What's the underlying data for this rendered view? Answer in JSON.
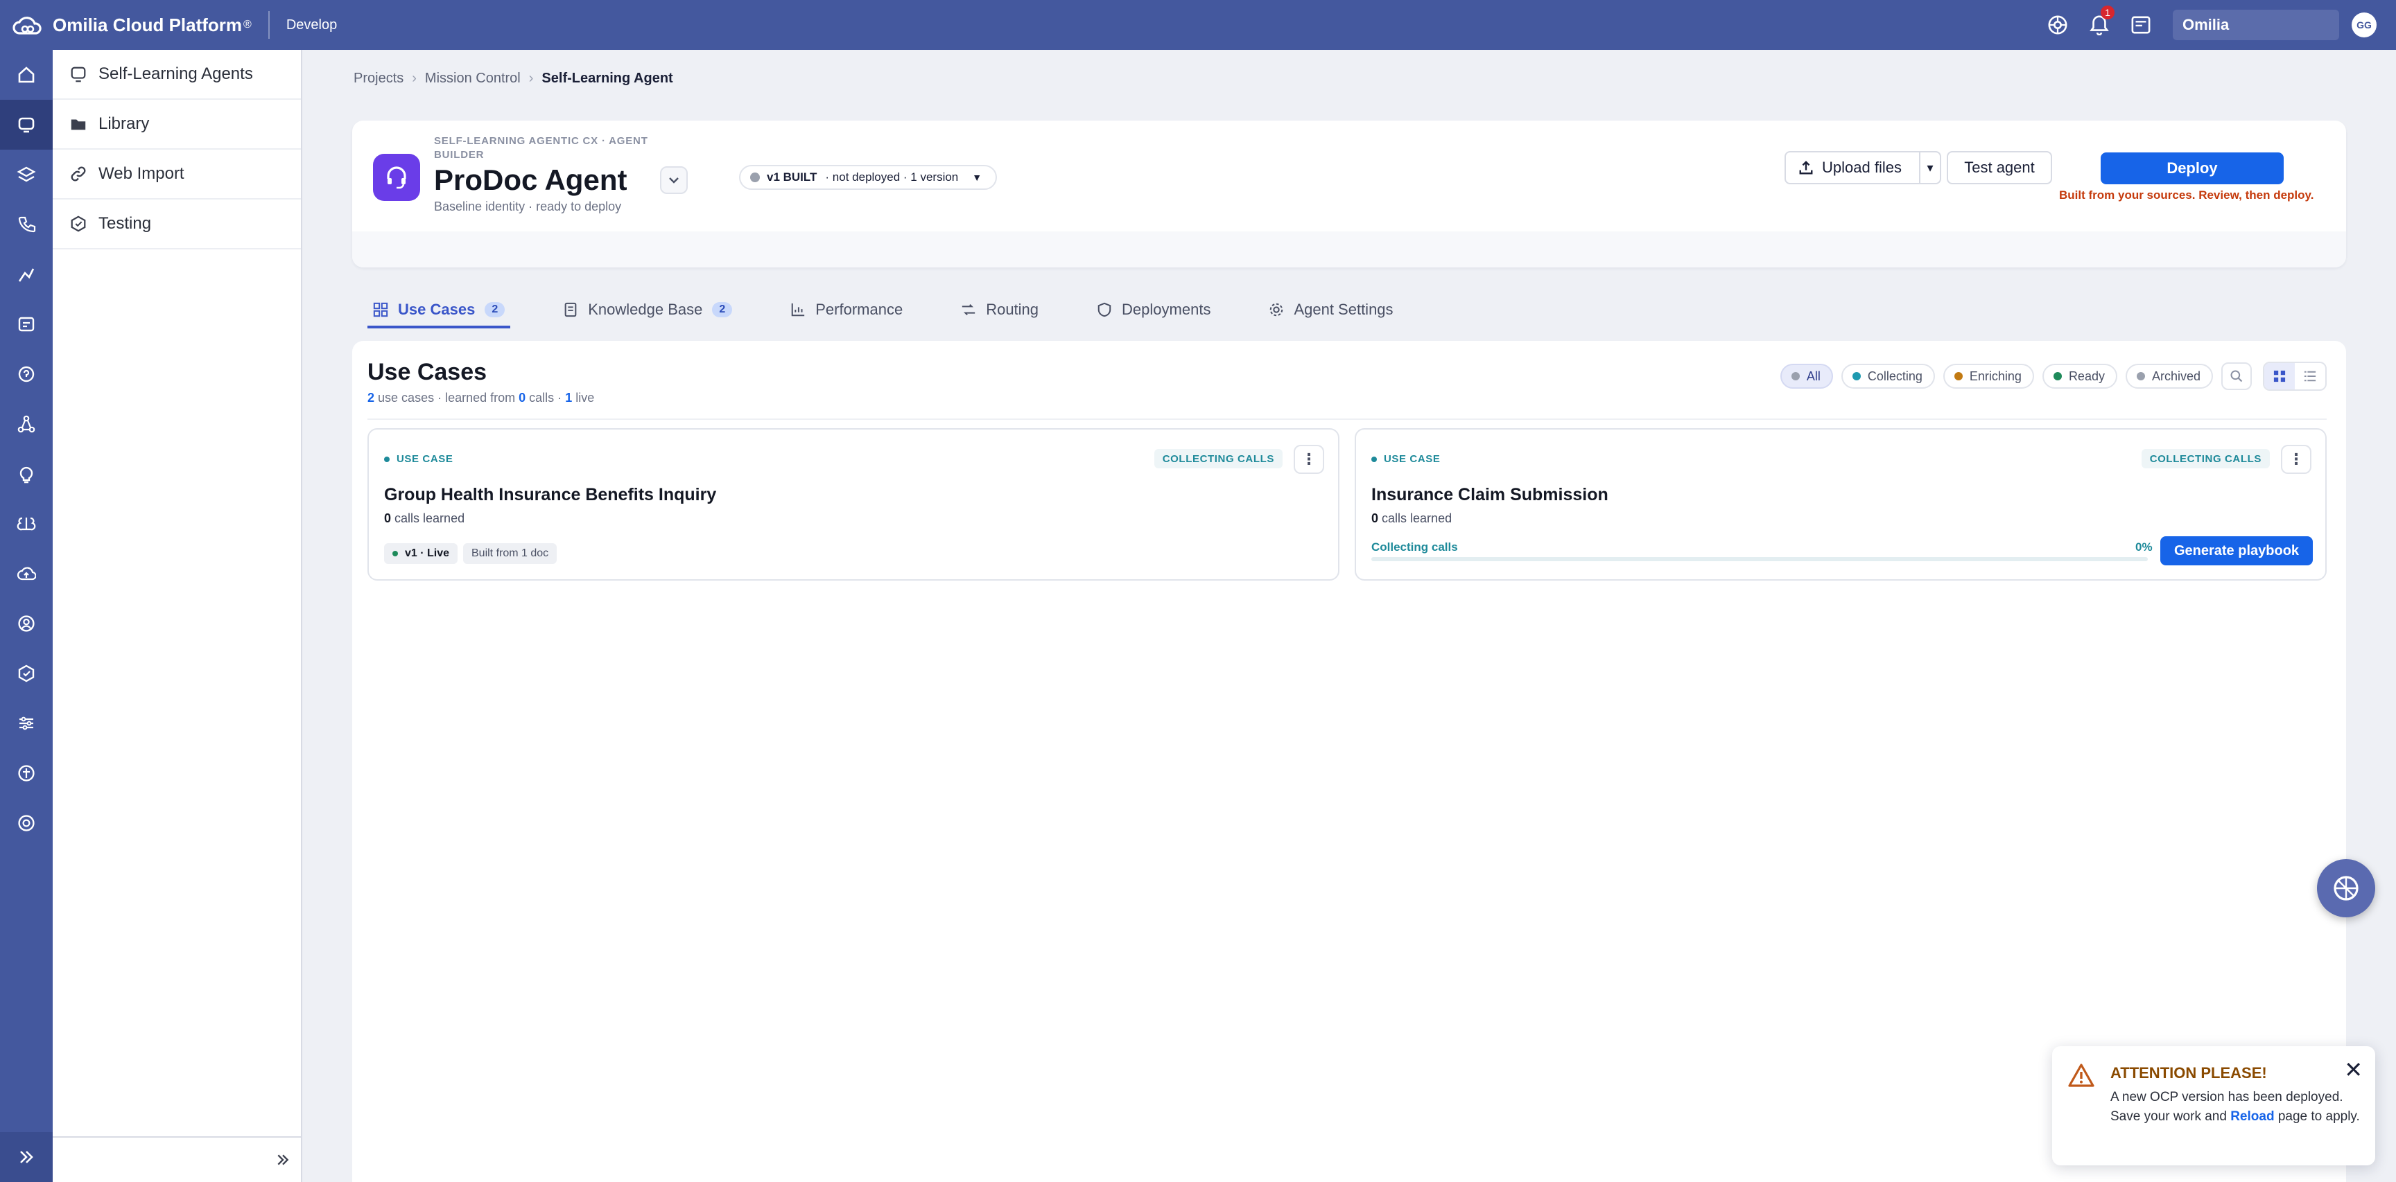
{
  "app": {
    "brand": "Omilia Cloud Platform",
    "brand_mark": "®",
    "section": "Develop",
    "notification_count": "1",
    "org": "Omilia",
    "user_initials": "GG"
  },
  "sidebar": {
    "items": [
      {
        "label": "Self-Learning Agents",
        "icon": "agents-icon"
      },
      {
        "label": "Library",
        "icon": "folder-icon"
      },
      {
        "label": "Web Import",
        "icon": "link-icon"
      },
      {
        "label": "Testing",
        "icon": "testing-icon"
      }
    ]
  },
  "breadcrumb": [
    "Projects",
    "Mission Control",
    "Self-Learning Agent"
  ],
  "agent": {
    "eyebrow": "SELF-LEARNING AGENTIC CX · AGENT BUILDER",
    "name": "ProDoc Agent",
    "subtitle": "Baseline identity · ready to deploy",
    "version_built": "v1 BUILT",
    "version_status": "· not deployed · 1 version",
    "upload_label": "Upload files",
    "test_label": "Test agent",
    "deploy_label": "Deploy",
    "deploy_note": "Built from your sources. Review, then deploy."
  },
  "tabs": [
    {
      "label": "Use Cases",
      "count": "2",
      "icon": "grid-icon"
    },
    {
      "label": "Knowledge Base",
      "count": "2",
      "icon": "book-icon"
    },
    {
      "label": "Performance",
      "icon": "chart-icon"
    },
    {
      "label": "Routing",
      "icon": "routing-icon"
    },
    {
      "label": "Deployments",
      "icon": "shield-icon"
    },
    {
      "label": "Agent Settings",
      "icon": "gear-icon"
    }
  ],
  "use_cases": {
    "title": "Use Cases",
    "summary": {
      "count": "2",
      "count_text": "use cases · learned from",
      "calls": "0",
      "calls_text": "calls ·",
      "live": "1",
      "live_text": "live"
    },
    "filters": [
      {
        "label": "All",
        "color": "#9aa0ad"
      },
      {
        "label": "Collecting",
        "color": "#1e9ab0"
      },
      {
        "label": "Enriching",
        "color": "#c27a12"
      },
      {
        "label": "Ready",
        "color": "#1e8a5a"
      },
      {
        "label": "Archived",
        "color": "#9aa0ad"
      }
    ],
    "cards": [
      {
        "kind": "USE CASE",
        "status": "COLLECTING CALLS",
        "title": "Group Health Insurance Benefits Inquiry",
        "calls": "0",
        "calls_text": "calls learned",
        "version_pill": "v1 · Live",
        "source_pill": "Built from 1 doc"
      },
      {
        "kind": "USE CASE",
        "status": "COLLECTING CALLS",
        "title": "Insurance Claim Submission",
        "calls": "0",
        "calls_text": "calls learned",
        "progress_label": "Collecting calls",
        "progress_pct": "0%",
        "progress_value": 0,
        "action_label": "Generate playbook"
      }
    ]
  },
  "toast": {
    "title": "ATTENTION PLEASE!",
    "body_before": "A new OCP version has been deployed. Save your work and",
    "link": "Reload",
    "body_after": "page to apply."
  }
}
